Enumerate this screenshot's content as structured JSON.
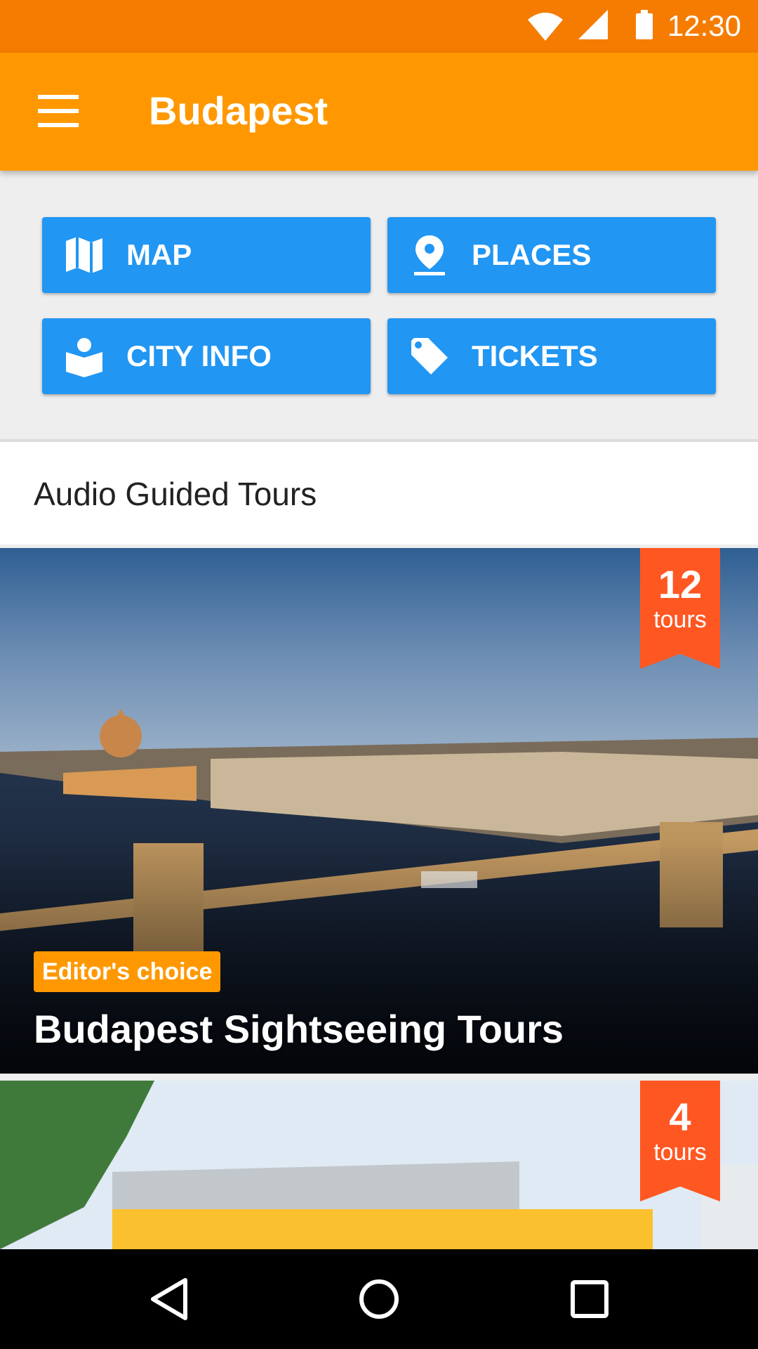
{
  "status_bar": {
    "time": "12:30",
    "icons": [
      "wifi-icon",
      "signal-icon",
      "battery-icon"
    ]
  },
  "app_bar": {
    "title": "Budapest",
    "menu_icon": "hamburger-menu-icon",
    "color": "#ff9800"
  },
  "quick_actions": [
    {
      "label": "MAP",
      "icon": "map-icon"
    },
    {
      "label": "PLACES",
      "icon": "place-pin-icon"
    },
    {
      "label": "CITY INFO",
      "icon": "city-info-icon"
    },
    {
      "label": "TICKETS",
      "icon": "ticket-tag-icon"
    }
  ],
  "section": {
    "title": "Audio Guided Tours"
  },
  "cards": [
    {
      "count": "12",
      "unit": "tours",
      "badge": "Editor's choice",
      "title": "Budapest Sightseeing Tours"
    },
    {
      "count": "4",
      "unit": "tours"
    }
  ],
  "colors": {
    "primary": "#ff9800",
    "status_bar": "#f57c00",
    "button": "#2196f3",
    "ribbon": "#ff5722"
  },
  "nav_bar": {
    "icons": [
      "back-icon",
      "home-icon",
      "recents-icon"
    ]
  }
}
